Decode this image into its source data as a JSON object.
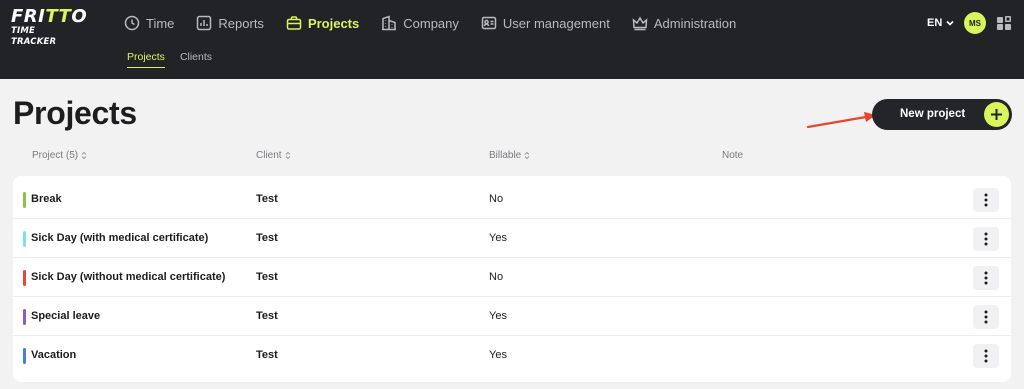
{
  "logo": {
    "line1_a": "FRI",
    "line1_b": "TT",
    "line1_c": "O",
    "line2": "TIME TRACKER"
  },
  "nav": {
    "items": [
      {
        "label": "Time",
        "icon": "clock-icon"
      },
      {
        "label": "Reports",
        "icon": "chart-icon"
      },
      {
        "label": "Projects",
        "icon": "briefcase-icon",
        "active": true
      },
      {
        "label": "Company",
        "icon": "building-icon"
      },
      {
        "label": "User management",
        "icon": "id-card-icon"
      },
      {
        "label": "Administration",
        "icon": "crown-icon"
      }
    ],
    "subitems": [
      {
        "label": "Projects",
        "active": true
      },
      {
        "label": "Clients"
      }
    ],
    "language": "EN",
    "avatar_initials": "MS"
  },
  "page": {
    "title": "Projects",
    "new_button": "New project"
  },
  "table": {
    "headers": {
      "project": "Project (5)",
      "client": "Client",
      "billable": "Billable",
      "note": "Note"
    },
    "rows": [
      {
        "name": "Break",
        "client": "Test",
        "billable": "No",
        "note": "",
        "color": "#8bc34a"
      },
      {
        "name": "Sick Day (with medical certificate)",
        "client": "Test",
        "billable": "Yes",
        "note": "",
        "color": "#7fe0f0"
      },
      {
        "name": "Sick Day (without medical certificate)",
        "client": "Test",
        "billable": "No",
        "note": "",
        "color": "#e0483c"
      },
      {
        "name": "Special leave",
        "client": "Test",
        "billable": "Yes",
        "note": "",
        "color": "#8e5cc9"
      },
      {
        "name": "Vacation",
        "client": "Test",
        "billable": "Yes",
        "note": "",
        "color": "#4a7be0"
      }
    ]
  },
  "colors": {
    "accent": "#d8f55c",
    "topbar": "#222327",
    "annotation_arrow": "#e8452c"
  }
}
